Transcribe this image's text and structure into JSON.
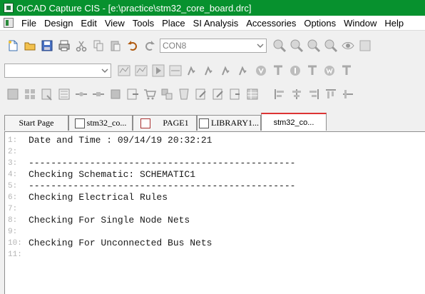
{
  "window": {
    "title": "OrCAD Capture CIS - [e:\\practice\\stm32_core_board.drc]"
  },
  "menu": [
    "File",
    "Design",
    "Edit",
    "View",
    "Tools",
    "Place",
    "SI Analysis",
    "Accessories",
    "Options",
    "Window",
    "Help"
  ],
  "toolbar": {
    "part_combo_value": "CON8",
    "second_combo_value": ""
  },
  "tabs": [
    {
      "label": "Start Page"
    },
    {
      "label": "stm32_co..."
    },
    {
      "label": "PAGE1"
    },
    {
      "label": "LIBRARY1..."
    },
    {
      "label": "stm32_co..."
    }
  ],
  "editor": {
    "lines": [
      {
        "num": "1:",
        "text": "Date and Time : 09/14/19 20:32:21"
      },
      {
        "num": "2:",
        "text": ""
      },
      {
        "num": "3:",
        "text": "------------------------------------------------"
      },
      {
        "num": "4:",
        "text": "Checking Schematic: SCHEMATIC1"
      },
      {
        "num": "5:",
        "text": "------------------------------------------------"
      },
      {
        "num": "6:",
        "text": "Checking Electrical Rules"
      },
      {
        "num": "7:",
        "text": ""
      },
      {
        "num": "8:",
        "text": "Checking For Single Node Nets"
      },
      {
        "num": "9:",
        "text": ""
      },
      {
        "num": "10:",
        "text": "Checking For Unconnected Bus Nets"
      },
      {
        "num": "11:",
        "text": ""
      }
    ]
  }
}
